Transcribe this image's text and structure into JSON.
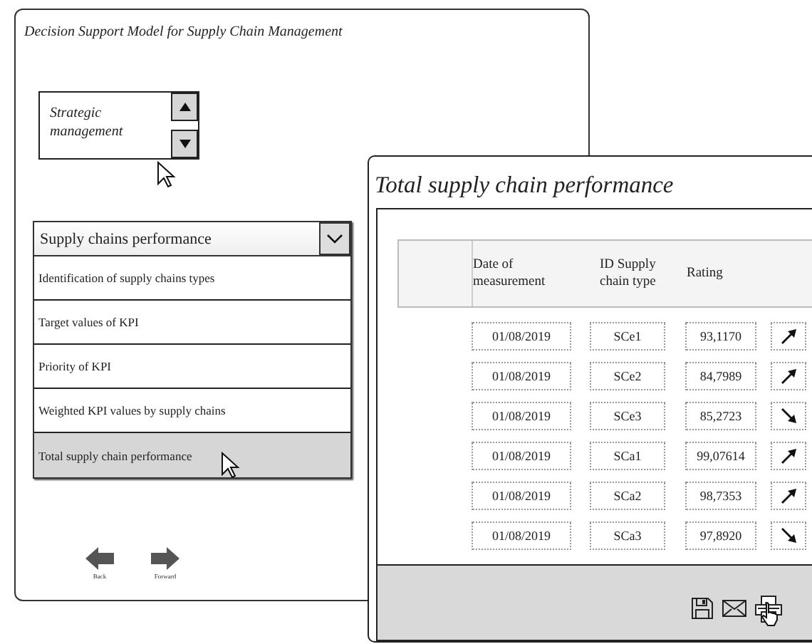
{
  "main_window": {
    "title": "Decision Support Model for Supply Chain Management",
    "level_picker": {
      "value": "Strategic management"
    },
    "dropdown": {
      "value": "Supply chains performance",
      "items": [
        {
          "label": "Identification of supply chains types",
          "selected": false
        },
        {
          "label": "Target values of  KPI",
          "selected": false
        },
        {
          "label": "Priority of KPI",
          "selected": false
        },
        {
          "label": "Weighted KPI values by supply chains",
          "selected": false
        },
        {
          "label": "Total supply chain performance",
          "selected": true
        }
      ]
    },
    "nav": [
      {
        "kind": "back",
        "label": "Back"
      },
      {
        "kind": "forward",
        "label": "Forward"
      }
    ]
  },
  "result_window": {
    "title": "Total supply chain performance",
    "table": {
      "columns": [
        "Date of measurement",
        "ID Supply chain type",
        "Rating"
      ],
      "rows": [
        {
          "date": "01/08/2019",
          "id": "SCe1",
          "rating": "93,1170",
          "rising": true
        },
        {
          "date": "01/08/2019",
          "id": "SCe2",
          "rating": "84,7989",
          "rising": true
        },
        {
          "date": "01/08/2019",
          "id": "SCe3",
          "rating": "85,2723",
          "rising": false
        },
        {
          "date": "01/08/2019",
          "id": "SCa1",
          "rating": "99,07614",
          "rising": true
        },
        {
          "date": "01/08/2019",
          "id": "SCa2",
          "rating": "98,7353",
          "rising": true
        },
        {
          "date": "01/08/2019",
          "id": "SCa3",
          "rating": "97,8920",
          "rising": false
        }
      ]
    },
    "actions": [
      {
        "kind": "save"
      },
      {
        "kind": "mail"
      },
      {
        "kind": "print"
      }
    ]
  }
}
